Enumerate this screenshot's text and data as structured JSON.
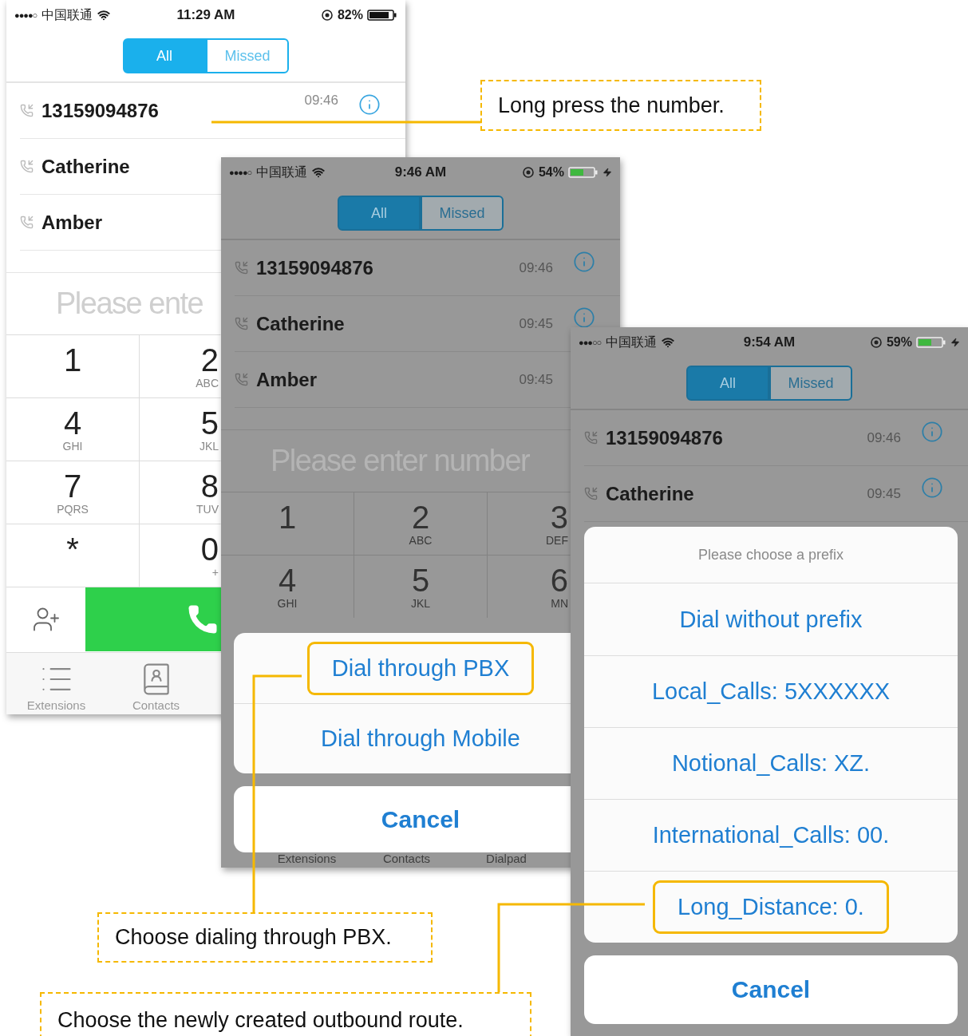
{
  "phones": [
    {
      "dimmed": false,
      "status": {
        "signal": "●●●●○",
        "carrier": "中国联通",
        "time": "11:29 AM",
        "battery": "82%",
        "charging": false
      },
      "segments": [
        {
          "label": "All",
          "selected": true
        },
        {
          "label": "Missed",
          "selected": false
        }
      ],
      "calls": [
        {
          "name": "13159094876",
          "time": "09:46",
          "info": true
        },
        {
          "name": "Catherine"
        },
        {
          "name": "Amber"
        }
      ],
      "dial_field": {
        "placeholder": "Please ente"
      },
      "keypad": [
        [
          {
            "digit": "1"
          },
          {
            "digit": "2",
            "letters": "ABC"
          }
        ],
        [
          {
            "digit": "4",
            "letters": "GHI"
          },
          {
            "digit": "5",
            "letters": "JKL"
          }
        ],
        [
          {
            "digit": "7",
            "letters": "PQRS"
          },
          {
            "digit": "8",
            "letters": "TUV"
          }
        ],
        [
          {
            "digit": "*"
          },
          {
            "digit": "0",
            "letters": "+"
          }
        ]
      ],
      "call_bar": true,
      "tabs": [
        {
          "label": "Extensions",
          "kind": "extensions"
        },
        {
          "label": "Contacts",
          "kind": "contacts"
        }
      ]
    },
    {
      "dimmed": true,
      "status": {
        "signal": "●●●●○",
        "carrier": "中国联通",
        "time": "9:46 AM",
        "battery": "54%",
        "charging": true
      },
      "segments": [
        {
          "label": "All",
          "selected": true
        },
        {
          "label": "Missed",
          "selected": false
        }
      ],
      "calls": [
        {
          "name": "13159094876",
          "time": "09:46",
          "info": true
        },
        {
          "name": "Catherine",
          "time": "09:45",
          "info": true
        },
        {
          "name": "Amber",
          "time": "09:45"
        }
      ],
      "dial_field": {
        "placeholder": "Please enter number"
      },
      "keypad": [
        [
          {
            "digit": "1"
          },
          {
            "digit": "2",
            "letters": "ABC"
          },
          {
            "digit": "3",
            "letters": "DEF"
          }
        ],
        [
          {
            "digit": "4",
            "letters": "GHI"
          },
          {
            "digit": "5",
            "letters": "JKL"
          },
          {
            "digit": "6",
            "letters": "MN"
          }
        ]
      ],
      "tabs": [
        {
          "label": "Extensions"
        },
        {
          "label": "Contacts"
        },
        {
          "label": "Dialpad"
        }
      ],
      "sheet": {
        "options": [
          {
            "label": "Dial through PBX",
            "highlighted": true
          },
          {
            "label": "Dial through Mobile",
            "highlighted": false
          }
        ],
        "cancel": "Cancel"
      }
    },
    {
      "dimmed": true,
      "status": {
        "signal": "●●●○○",
        "carrier": "中国联通",
        "time": "9:54 AM",
        "battery": "59%",
        "charging": true
      },
      "segments": [
        {
          "label": "All",
          "selected": true
        },
        {
          "label": "Missed",
          "selected": false
        }
      ],
      "calls": [
        {
          "name": "13159094876",
          "time": "09:46",
          "info": true
        },
        {
          "name": "Catherine",
          "time": "09:45",
          "info": true
        }
      ],
      "sheet": {
        "title": "Please choose a prefix",
        "options": [
          {
            "label": "Dial without prefix",
            "highlighted": false
          },
          {
            "label": "Local_Calls: 5XXXXXX",
            "highlighted": false
          },
          {
            "label": "Notional_Calls: XZ.",
            "highlighted": false
          },
          {
            "label": "International_Calls: 00.",
            "highlighted": false
          },
          {
            "label": "Long_Distance: 0.",
            "highlighted": true
          }
        ],
        "cancel": "Cancel"
      }
    }
  ],
  "callouts": [
    {
      "text": "Long press the number."
    },
    {
      "text": "Choose dialing through PBX."
    },
    {
      "text": "Choose the newly created outbound route."
    }
  ]
}
